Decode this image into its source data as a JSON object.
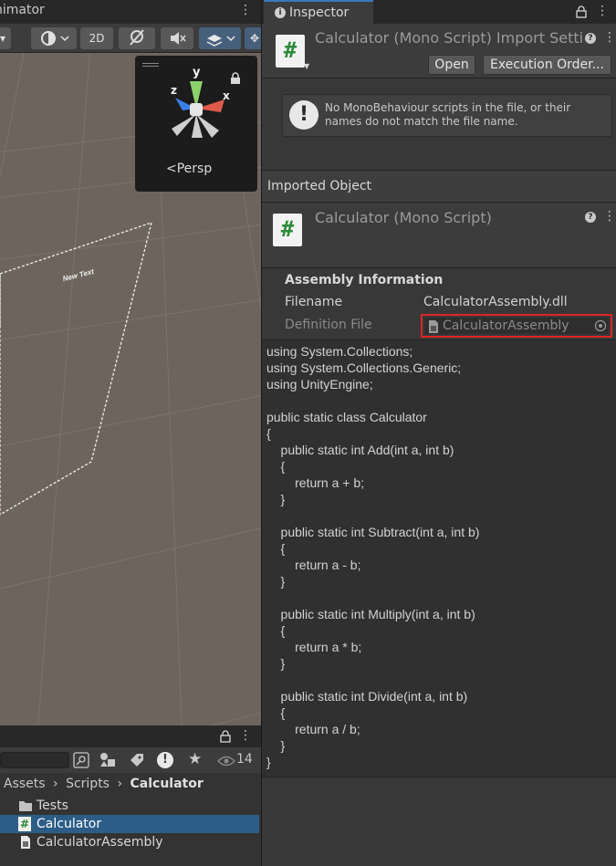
{
  "scene": {
    "tab_label": "nimator",
    "toolbar": {
      "btn_2d": "2D"
    },
    "gizmo": {
      "axis_y": "y",
      "axis_x": "x",
      "axis_z": "z",
      "projection": "Persp"
    },
    "canvas_label": "New Text"
  },
  "project": {
    "hidden_count": "14",
    "breadcrumb": [
      "Assets",
      "Scripts",
      "Calculator"
    ],
    "items": [
      {
        "label": "Tests",
        "icon": "folder-icon",
        "selected": false
      },
      {
        "label": "Calculator",
        "icon": "csharp-script-icon",
        "selected": true
      },
      {
        "label": "CalculatorAssembly",
        "icon": "assembly-definition-icon",
        "selected": false
      }
    ]
  },
  "inspector": {
    "tab_label": "Inspector",
    "header": {
      "title": "Calculator (Mono Script) Import Setti",
      "open_label": "Open",
      "exec_order_label": "Execution Order..."
    },
    "warning": "No MonoBehaviour scripts in the file, or their names do not match the file name.",
    "imported_object_label": "Imported Object",
    "object_title": "Calculator (Mono Script)",
    "assembly": {
      "heading": "Assembly Information",
      "filename_label": "Filename",
      "filename_value": "CalculatorAssembly.dll",
      "definition_label": "Definition File",
      "definition_value": "CalculatorAssembly"
    },
    "code": [
      "using System.Collections;",
      "using System.Collections.Generic;",
      "using UnityEngine;",
      "",
      "public static class Calculator",
      "{",
      "    public static int Add(int a, int b)",
      "    {",
      "        return a + b;",
      "    }",
      "",
      "    public static int Subtract(int a, int b)",
      "    {",
      "        return a - b;",
      "    }",
      "",
      "    public static int Multiply(int a, int b)",
      "    {",
      "        return a * b;",
      "    }",
      "",
      "    public static int Divide(int a, int b)",
      "    {",
      "        return a / b;",
      "    }",
      "}"
    ]
  },
  "colors": {
    "accent": "#3a79bb",
    "selection": "#2c5d87",
    "highlight": "#e02424",
    "script_green": "#2c8a3a"
  }
}
